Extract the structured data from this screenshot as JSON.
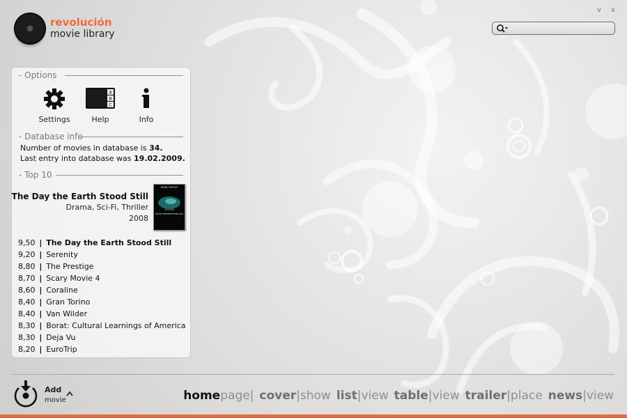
{
  "header": {
    "brand_line1": "revolución",
    "brand_line2": "movie library",
    "minimize_label": "v",
    "close_label": "x",
    "search_placeholder": "",
    "search_icon": "search-icon"
  },
  "options": {
    "section_title": "- Options",
    "items": [
      {
        "label": "Settings",
        "icon": "gear-icon"
      },
      {
        "label": "Help",
        "icon": "help-abc-icon"
      },
      {
        "label": "Info",
        "icon": "info-icon"
      }
    ]
  },
  "database": {
    "section_title": "- Database info",
    "line1_text": "Number of movies in database is",
    "movie_count": "34.",
    "line2_text": "Last entry into database was",
    "last_entry": "19.02.2009."
  },
  "top10": {
    "section_title": "- Top 10",
    "featured": {
      "title": "The Day the Earth Stood Still",
      "genres": "Drama, Sci-Fi, Thriller",
      "year": "2008",
      "poster_top_text": "KEANU REEVES",
      "poster_date_text": "12.12.08",
      "poster_title_text": "THE DAY THE EARTH STOOD STILL"
    },
    "items": [
      {
        "score": "9,50",
        "title": "The Day the Earth Stood Still"
      },
      {
        "score": "9,20",
        "title": "Serenity"
      },
      {
        "score": "8,80",
        "title": "The Prestige"
      },
      {
        "score": "8,70",
        "title": "Scary Movie 4"
      },
      {
        "score": "8,60",
        "title": "Coraline"
      },
      {
        "score": "8,40",
        "title": "Gran Torino"
      },
      {
        "score": "8,40",
        "title": "Van Wilder"
      },
      {
        "score": "8,30",
        "title": "Borat: Cultural Learnings of America for"
      },
      {
        "score": "8,30",
        "title": "Deja Vu"
      },
      {
        "score": "8,20",
        "title": "EuroTrip"
      }
    ]
  },
  "bottom": {
    "add_label": "Add",
    "add_sublabel": "movie",
    "add_icon": "add-movie-icon",
    "nav": [
      {
        "bold": "home",
        "light": "page|",
        "current": true
      },
      {
        "bold": "cover",
        "light": "|show",
        "current": false
      },
      {
        "bold": "list",
        "light": "|view",
        "current": false
      },
      {
        "bold": "table",
        "light": "|view",
        "current": false
      },
      {
        "bold": "trailer",
        "light": "|place",
        "current": false
      },
      {
        "bold": "news",
        "light": "|view",
        "current": false
      }
    ]
  },
  "colors": {
    "accent": "#e8693e",
    "brand_orange": "#ef6c3c",
    "background": "#dcdcdc"
  }
}
